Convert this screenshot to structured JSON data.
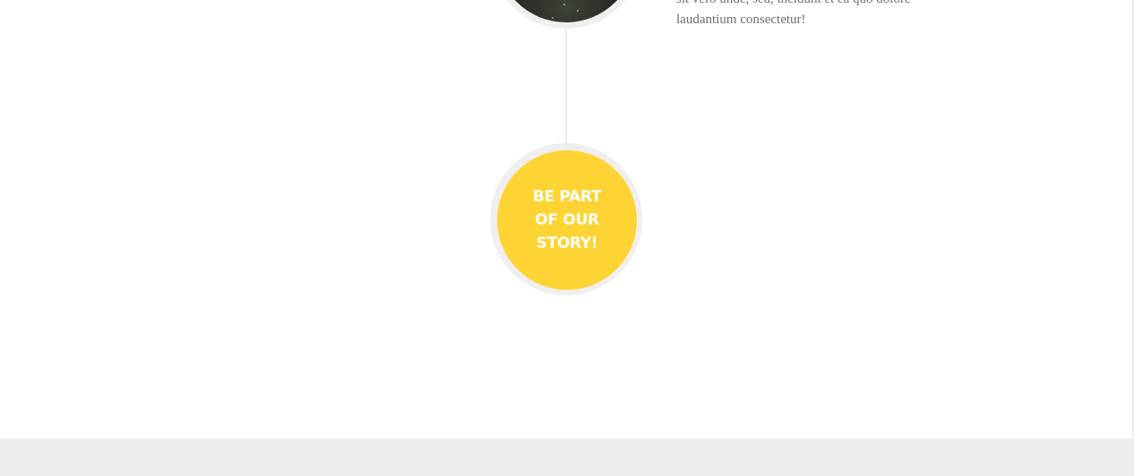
{
  "timeline": {
    "event_text": "sit vero unde, sed, incidunt et ea quo dolore laudantium consectetur!",
    "photo_icon": "night-sky-photo",
    "cta": {
      "lines": [
        "BE PART",
        "OF OUR",
        "STORY!"
      ],
      "color": "#fed434",
      "text_color": "#ffffff"
    }
  },
  "colors": {
    "background": "#ffffff",
    "footer": "#eeeeee",
    "line": "#ebebeb",
    "body_text": "#6f6f6f"
  }
}
